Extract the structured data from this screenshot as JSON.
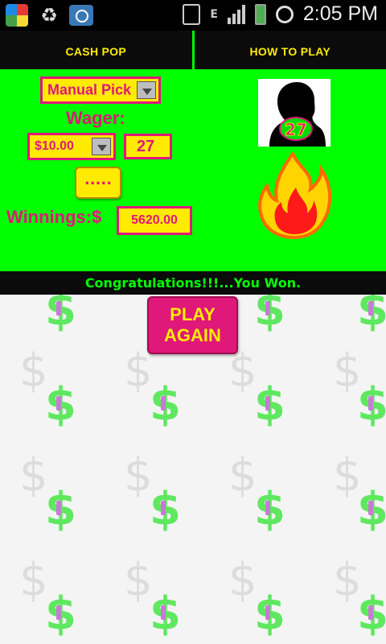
{
  "status_bar": {
    "time": "2:05 PM",
    "network": "E"
  },
  "tabs": [
    {
      "label": "CASH POP"
    },
    {
      "label": "HOW TO PLAY"
    }
  ],
  "game": {
    "pick_mode": "Manual Pick",
    "wager_label": "Wager:",
    "wager_amount": "$10.00",
    "picked_number": "27",
    "dots_label": ".....",
    "winnings_label": "Winnings:$",
    "winnings_value": "5620.00",
    "drawn_number": "27"
  },
  "result": {
    "message": "Congratulations!!!...You Won."
  },
  "actions": {
    "play_again": "PLAY AGAIN"
  },
  "colors": {
    "accent_green": "#00ff00",
    "accent_pink": "#e0187a",
    "accent_yellow": "#ffeb00"
  }
}
